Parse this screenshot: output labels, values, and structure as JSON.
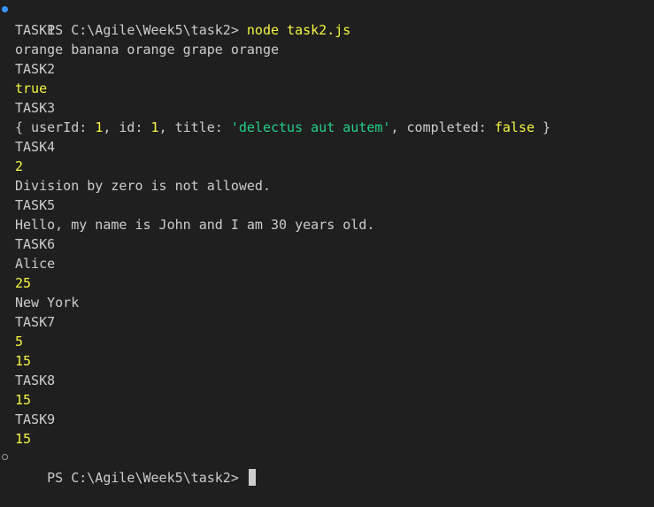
{
  "terminal": {
    "prompt1": "PS C:\\Agile\\Week5\\task2> ",
    "command": "node task2.js",
    "task1_header": "TASK1",
    "task1_output": "orange banana orange grape orange",
    "task2_header": "TASK2",
    "task2_output": "true",
    "task3_header": "TASK3",
    "task3_object": {
      "open": "{ userId: ",
      "userId": "1",
      "sep1": ", id: ",
      "id": "1",
      "sep2": ", title: ",
      "title": "'delectus aut autem'",
      "sep3": ", completed: ",
      "completed": "false",
      "close": " }"
    },
    "task4_header": "TASK4",
    "task4_output1": "2",
    "task4_output2": "Division by zero is not allowed.",
    "task5_header": "TASK5",
    "task5_output": "Hello, my name is John and I am 30 years old.",
    "task6_header": "TASK6",
    "task6_name": "Alice",
    "task6_age": "25",
    "task6_city": "New York",
    "task7_header": "TASK7",
    "task7_output1": "5",
    "task7_output2": "15",
    "task8_header": "TASK8",
    "task8_output": "15",
    "task9_header": "TASK9",
    "task9_output": "15",
    "prompt2": "PS C:\\Agile\\Week5\\task2> "
  },
  "colors": {
    "background": "#1f1f1f",
    "text": "#cccccc",
    "yellow": "#f5f543",
    "green": "#23d18b",
    "decoration_success": "#3794ff"
  }
}
